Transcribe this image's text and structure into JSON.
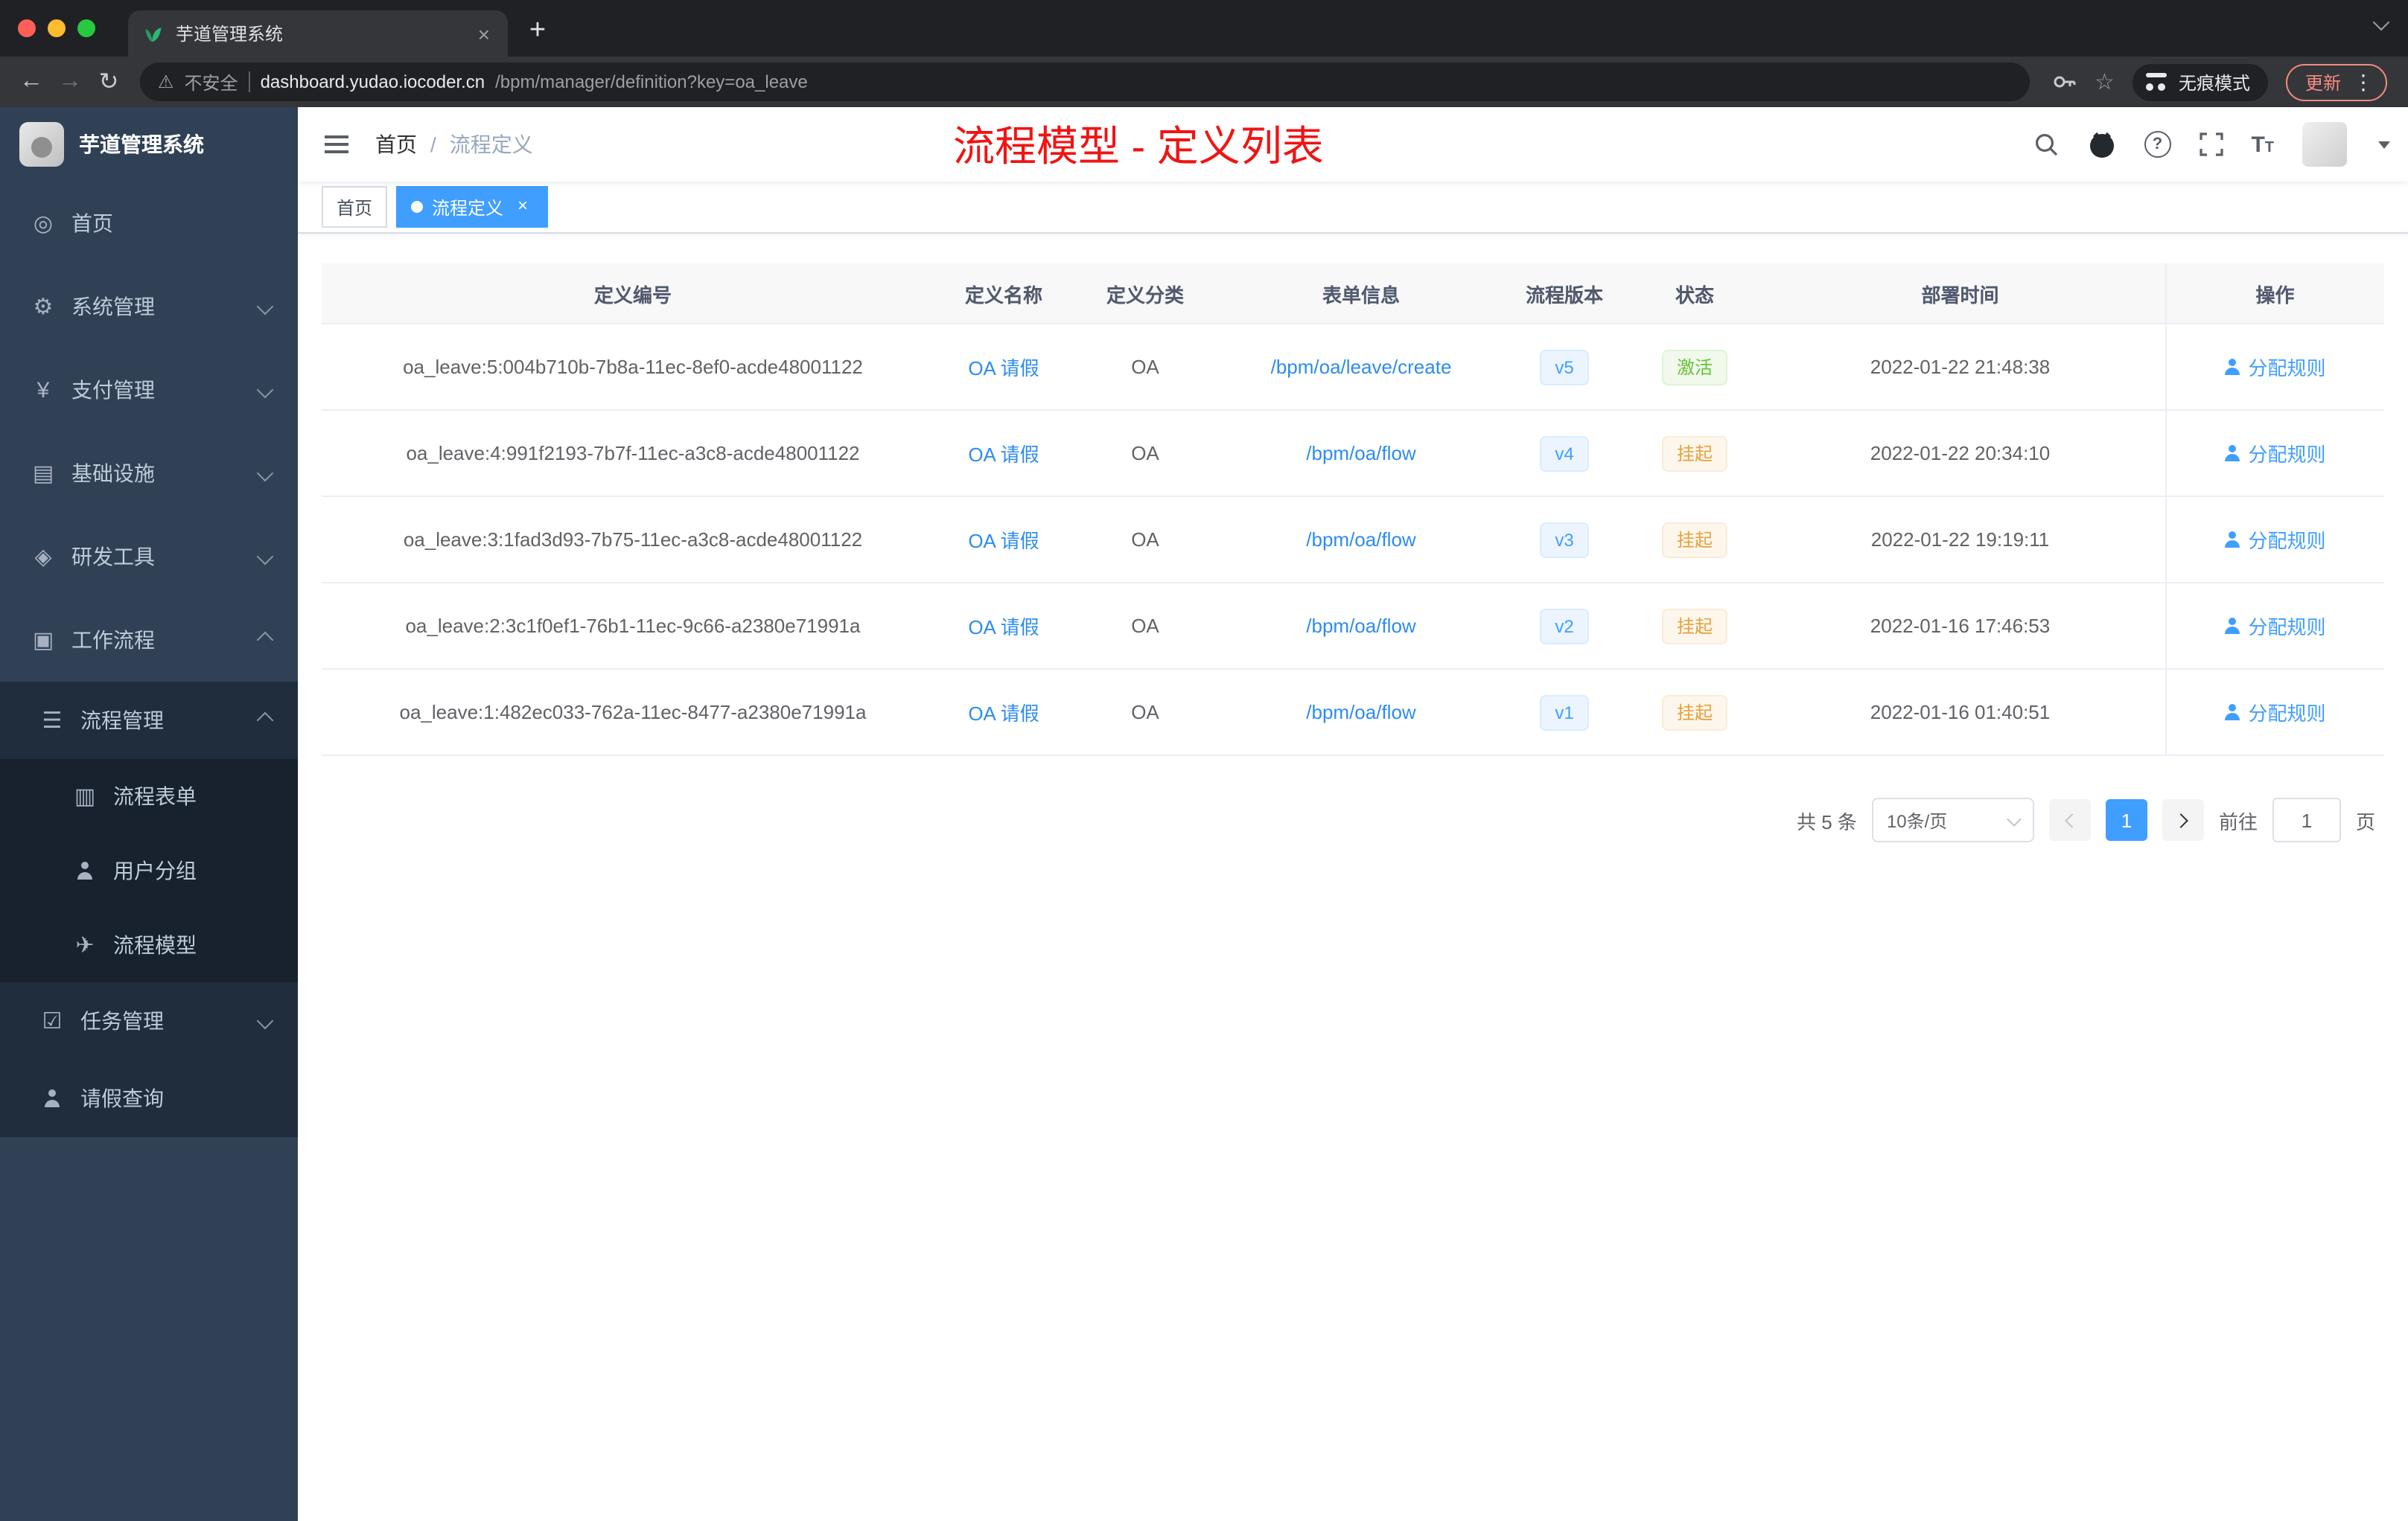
{
  "colors": {
    "accent": "#409eff",
    "link": "#2d8cf0",
    "title_red": "#f01414",
    "status_active": "#67c23a",
    "status_suspended": "#e6a23c",
    "sidebar_bg": "#304156"
  },
  "browser": {
    "tab_title": "芋道管理系统",
    "security_label": "不安全",
    "url_host": "dashboard.yudao.iocoder.cn",
    "url_path": "/bpm/manager/definition?key=oa_leave",
    "incognito_label": "无痕模式",
    "update_label": "更新"
  },
  "sidebar": {
    "logo_title": "芋道管理系统",
    "items": [
      {
        "name": "home",
        "icon": "dashboard-icon",
        "glyph": "◎",
        "label": "首页",
        "level": 1
      },
      {
        "name": "system-management",
        "icon": "gear-icon",
        "glyph": "⚙",
        "label": "系统管理",
        "level": 1,
        "chevron": "down"
      },
      {
        "name": "payment-management",
        "icon": "yen-icon",
        "glyph": "¥",
        "label": "支付管理",
        "level": 1,
        "chevron": "down"
      },
      {
        "name": "infrastructure",
        "icon": "grid-icon",
        "glyph": "▤",
        "label": "基础设施",
        "level": 1,
        "chevron": "down"
      },
      {
        "name": "dev-tools",
        "icon": "toolbox-icon",
        "glyph": "◈",
        "label": "研发工具",
        "level": 1,
        "chevron": "down"
      },
      {
        "name": "workflow",
        "icon": "workflow-icon",
        "glyph": "▣",
        "label": "工作流程",
        "level": 1,
        "chevron": "up"
      },
      {
        "name": "process-management",
        "icon": "list-icon",
        "glyph": "☰",
        "label": "流程管理",
        "level": 2,
        "chevron": "up"
      },
      {
        "name": "process-form",
        "icon": "document-icon",
        "glyph": "▥",
        "label": "流程表单",
        "level": 3
      },
      {
        "name": "user-group",
        "icon": "person-icon",
        "glyph": "person",
        "label": "用户分组",
        "level": 3
      },
      {
        "name": "process-model",
        "icon": "paper-plane-icon",
        "glyph": "✈",
        "label": "流程模型",
        "level": 3
      },
      {
        "name": "task-management",
        "icon": "task-icon",
        "glyph": "☑",
        "label": "任务管理",
        "level": 2,
        "chevron": "down"
      },
      {
        "name": "leave-query",
        "icon": "person-icon",
        "glyph": "person",
        "label": "请假查询",
        "level": 2
      }
    ]
  },
  "header": {
    "breadcrumb_home": "首页",
    "breadcrumb_sep": "/",
    "breadcrumb_current": "流程定义",
    "overlay_title": "流程模型 - 定义列表"
  },
  "tags": [
    {
      "label": "首页",
      "active": false
    },
    {
      "label": "流程定义",
      "active": true
    }
  ],
  "table": {
    "columns": [
      "定义编号",
      "定义名称",
      "定义分类",
      "表单信息",
      "流程版本",
      "状态",
      "部署时间",
      "操作"
    ],
    "action_label": "分配规则",
    "rows": [
      {
        "id": "oa_leave:5:004b710b-7b8a-11ec-8ef0-acde48001122",
        "name": "OA 请假",
        "category": "OA",
        "form": "/bpm/oa/leave/create",
        "version": "v5",
        "status": "激活",
        "status_type": "active",
        "deployed": "2022-01-22 21:48:38"
      },
      {
        "id": "oa_leave:4:991f2193-7b7f-11ec-a3c8-acde48001122",
        "name": "OA 请假",
        "category": "OA",
        "form": "/bpm/oa/flow",
        "version": "v4",
        "status": "挂起",
        "status_type": "suspended",
        "deployed": "2022-01-22 20:34:10"
      },
      {
        "id": "oa_leave:3:1fad3d93-7b75-11ec-a3c8-acde48001122",
        "name": "OA 请假",
        "category": "OA",
        "form": "/bpm/oa/flow",
        "version": "v3",
        "status": "挂起",
        "status_type": "suspended",
        "deployed": "2022-01-22 19:19:11"
      },
      {
        "id": "oa_leave:2:3c1f0ef1-76b1-11ec-9c66-a2380e71991a",
        "name": "OA 请假",
        "category": "OA",
        "form": "/bpm/oa/flow",
        "version": "v2",
        "status": "挂起",
        "status_type": "suspended",
        "deployed": "2022-01-16 17:46:53"
      },
      {
        "id": "oa_leave:1:482ec033-762a-11ec-8477-a2380e71991a",
        "name": "OA 请假",
        "category": "OA",
        "form": "/bpm/oa/flow",
        "version": "v1",
        "status": "挂起",
        "status_type": "suspended",
        "deployed": "2022-01-16 01:40:51"
      }
    ]
  },
  "pagination": {
    "total": "共 5 条",
    "page_size": "10条/页",
    "current": "1",
    "goto": "前往",
    "goto_value": "1",
    "page_unit": "页"
  }
}
